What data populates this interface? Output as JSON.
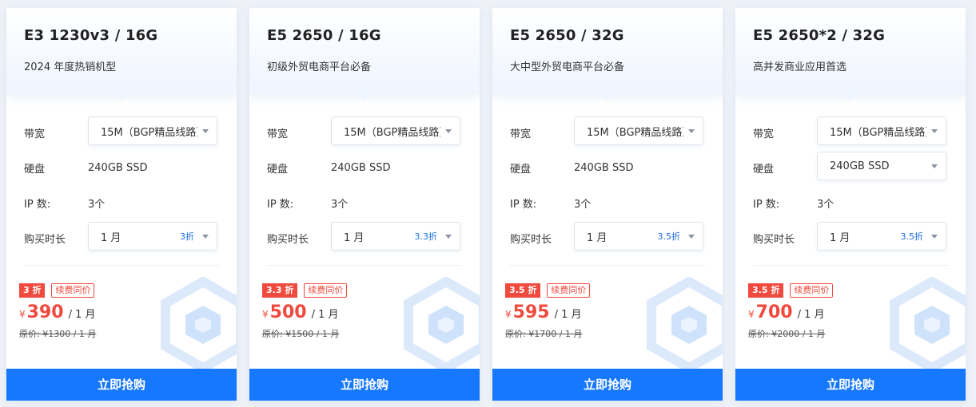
{
  "labels": {
    "bandwidth": "带宽",
    "disk": "硬盘",
    "ip": "IP 数:",
    "duration": "购买时长",
    "renew": "续费同价",
    "per_month": "/ 1 月",
    "currency": "¥",
    "buy": "立即抢购"
  },
  "colors": {
    "accent": "#1677ff",
    "price_red": "#f04a3e"
  },
  "cards": [
    {
      "title": "E3 1230v3 / 16G",
      "subtitle": "2024 年度热销机型",
      "bandwidth": "15M（BGP精品线路）",
      "disk": "240GB SSD",
      "disk_is_select": false,
      "ip": "3个",
      "duration": "1 月",
      "duration_discount": "3折",
      "badge": "3 折",
      "price": "390",
      "original": "原价: ¥1300 / 1 月"
    },
    {
      "title": "E5 2650 / 16G",
      "subtitle": "初级外贸电商平台必备",
      "bandwidth": "15M（BGP精品线路）",
      "disk": "240GB SSD",
      "disk_is_select": false,
      "ip": "3个",
      "duration": "1 月",
      "duration_discount": "3.3折",
      "badge": "3.3 折",
      "price": "500",
      "original": "原价: ¥1500 / 1 月"
    },
    {
      "title": "E5 2650 / 32G",
      "subtitle": "大中型外贸电商平台必备",
      "bandwidth": "15M（BGP精品线路）",
      "disk": "240GB SSD",
      "disk_is_select": false,
      "ip": "3个",
      "duration": "1 月",
      "duration_discount": "3.5折",
      "badge": "3.5 折",
      "price": "595",
      "original": "原价: ¥1700 / 1 月"
    },
    {
      "title": "E5 2650*2 / 32G",
      "subtitle": "高并发商业应用首选",
      "bandwidth": "15M（BGP精品线路）",
      "disk": "240GB SSD",
      "disk_is_select": true,
      "ip": "3个",
      "duration": "1 月",
      "duration_discount": "3.5折",
      "badge": "3.5 折",
      "price": "700",
      "original": "原价: ¥2000 / 1 月"
    }
  ]
}
